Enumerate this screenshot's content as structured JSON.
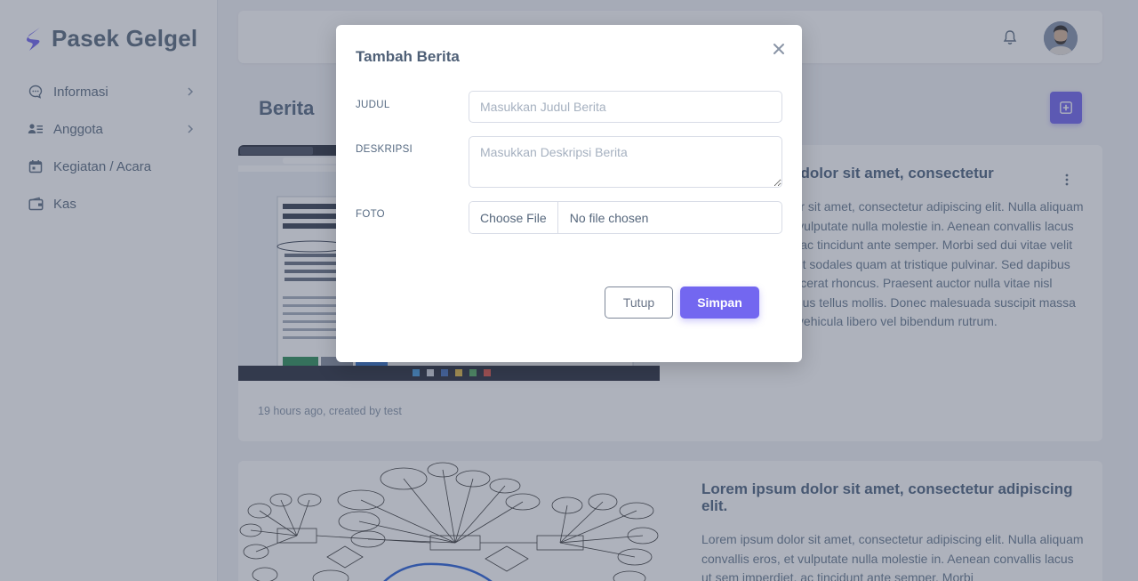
{
  "brand": {
    "name": "Pasek Gelgel"
  },
  "sidebar": {
    "items": [
      {
        "label": "Informasi",
        "icon": "chat-icon",
        "has_children": true
      },
      {
        "label": "Anggota",
        "icon": "users-list-icon",
        "has_children": true
      },
      {
        "label": "Kegiatan / Acara",
        "icon": "calendar-icon",
        "has_children": false
      },
      {
        "label": "Kas",
        "icon": "wallet-icon",
        "has_children": false
      }
    ]
  },
  "topbar": {
    "icons": [
      "bell-icon",
      "user-avatar"
    ]
  },
  "page": {
    "title": "Berita"
  },
  "cards": [
    {
      "title": "Lorem ipsum dolor sit amet, consectetur",
      "body": "Lorem ipsum dolor sit amet, consectetur adipiscing elit. Nulla aliquam convallis eros, et vulputate nulla molestie in. Aenean convallis lacus ut sem imperdiet, ac tincidunt ante semper. Morbi sed dui vitae velit laoreet dapibus. Ut sodales quam at tristique pulvinar. Sed dapibus lorem et turpis placerat rhoncus. Praesent auctor nulla vitae nisl tempus, vitae cursus tellus mollis. Donec malesuada suscipit massa eu efficitur. Nunc vehicula libero vel bibendum rutrum.",
      "meta": "19 hours ago, created by test"
    },
    {
      "title": "Lorem ipsum dolor sit amet, consectetur adipiscing elit.",
      "body": "Lorem ipsum dolor sit amet, consectetur adipiscing elit. Nulla aliquam convallis eros, et vulputate nulla molestie in. Aenean convallis lacus ut sem imperdiet, ac tincidunt ante semper. Morbi"
    }
  ],
  "modal": {
    "title": "Tambah Berita",
    "fields": {
      "judul_label": "JUDUL",
      "judul_placeholder": "Masukkan Judul Berita",
      "deskripsi_label": "DESKRIPSI",
      "deskripsi_placeholder": "Masukkan Deskripsi Berita",
      "foto_label": "FOTO",
      "file_button": "Choose File",
      "file_status": "No file chosen"
    },
    "buttons": {
      "close": "Tutup",
      "save": "Simpan"
    }
  },
  "colors": {
    "accent": "#7367f0",
    "sidebar_text": "#5e6f84",
    "brand_text": "#5a6b7e",
    "overlay": "rgba(62,72,96,0.42)"
  }
}
